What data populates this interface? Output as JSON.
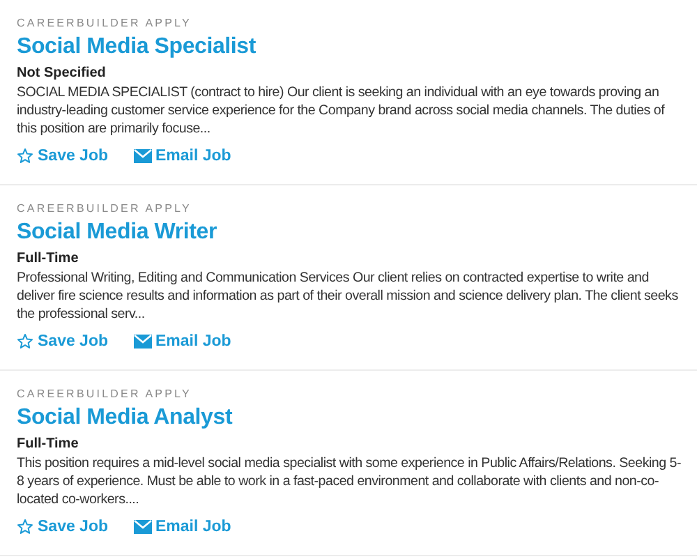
{
  "jobs": [
    {
      "source": "CAREERBUILDER APPLY",
      "title": "Social Media Specialist",
      "type": "Not Specified",
      "description": "SOCIAL MEDIA SPECIALIST (contract to hire) Our client is seeking an individual with an eye towards proving an industry-leading customer service experience for the Company brand across social media channels. The duties of this position are primarily focuse...",
      "actions": [
        {
          "kind": "save",
          "label": "Save Job"
        },
        {
          "kind": "email",
          "label": "Email Job"
        }
      ]
    },
    {
      "source": "CAREERBUILDER APPLY",
      "title": "Social Media Writer",
      "type": "Full-Time",
      "description": "Professional Writing, Editing and Communication Services Our client relies on contracted expertise to write and deliver fire science results and information as part of their overall mission and science delivery plan. The client seeks the professional serv...",
      "actions": [
        {
          "kind": "save",
          "label": "Save Job"
        },
        {
          "kind": "email",
          "label": "Email Job"
        }
      ]
    },
    {
      "source": "CAREERBUILDER APPLY",
      "title": "Social Media Analyst",
      "type": "Full-Time",
      "description": "This position requires a mid-level social media specialist with some experience in Public Affairs/Relations. Seeking 5-8 years of experience. Must be able to work in a fast-paced environment and collaborate with clients and non-co-located co-workers....",
      "actions": [
        {
          "kind": "save",
          "label": "Save Job"
        },
        {
          "kind": "email",
          "label": "Email Job"
        }
      ]
    }
  ]
}
